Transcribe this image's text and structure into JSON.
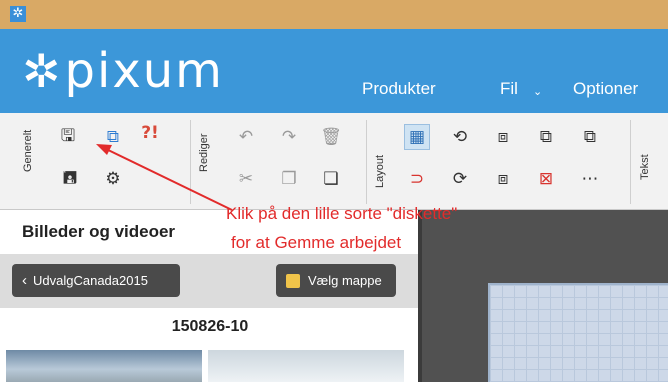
{
  "app": {
    "window_icon": "gear-sun-icon",
    "brand": "pixum",
    "logo_icon": "pixum-flower-icon"
  },
  "menu": {
    "produkter": "Produkter",
    "fil": "Fil",
    "optioner": "Optioner"
  },
  "ribbon": {
    "groups": {
      "generelt": "Generelt",
      "rediger": "Rediger",
      "layout": "Layout",
      "tekst": "Tekst"
    },
    "icons": {
      "generelt": [
        "save-icon",
        "export-icon",
        "help-icon",
        "save-as-icon",
        "settings-icon"
      ],
      "rediger": [
        "undo-icon",
        "redo-icon",
        "delete-icon",
        "cut-icon",
        "copy-icon",
        "paste-icon"
      ],
      "layout": [
        "grid-icon",
        "rotate-icon",
        "send-back-icon",
        "arrange-icon",
        "arrange-front-icon",
        "magnet-icon",
        "rotate-left-icon",
        "bring-forward-icon",
        "delete-layout-icon",
        "more-icon"
      ]
    }
  },
  "annotation": {
    "line1": "Klik på den lille sorte \"diskette\"",
    "line2": "for at Gemme arbejdet",
    "color": "#e22b2b"
  },
  "left_panel": {
    "title": "Billeder og videoer",
    "back_button": "UdvalgCanada2015",
    "folder_button": "Vælg mappe",
    "album_name": "150826-10"
  },
  "colors": {
    "header": "#3c97d9",
    "titlebar": "#d9a965",
    "dark_button": "#4a4a4a"
  }
}
